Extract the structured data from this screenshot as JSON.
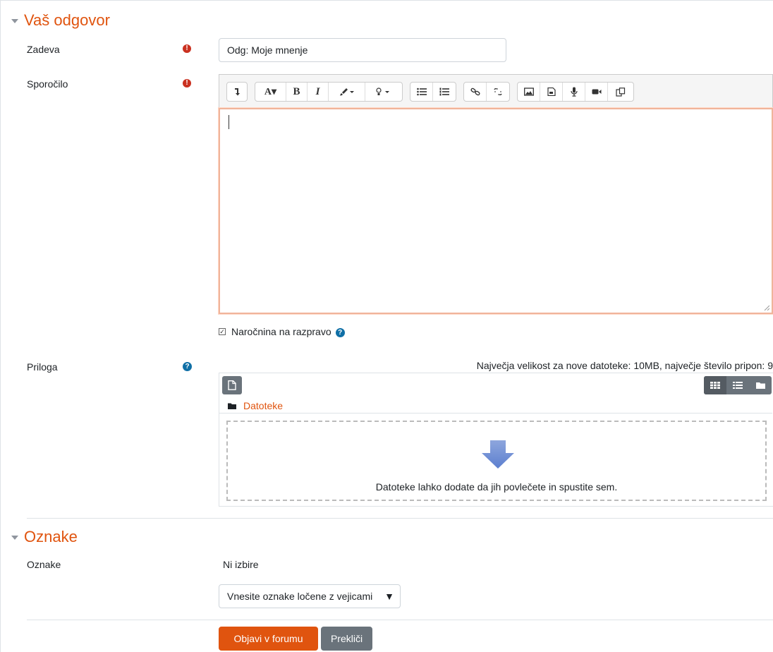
{
  "section_reply": {
    "title": "Vaš odgovor"
  },
  "subject": {
    "label": "Zadeva",
    "value": "Odg: Moje mnenje",
    "required_icon": "exclamation-circle-icon"
  },
  "message": {
    "label": "Sporočilo",
    "required_icon": "exclamation-circle-icon",
    "content": ""
  },
  "toolbar": {
    "items": [
      "collapse-icon",
      "font-icon",
      "bold-icon",
      "italic-icon",
      "brush-icon",
      "lightbulb-icon",
      "unordered-list-icon",
      "ordered-list-icon",
      "link-icon",
      "unlink-icon",
      "image-icon",
      "media-icon",
      "microphone-icon",
      "video-icon",
      "copy-icon"
    ],
    "font_glyph": "A▾",
    "bold_glyph": "B",
    "italic_glyph": "I"
  },
  "subscribe": {
    "label": "Naročnina na razpravo",
    "checked": true,
    "help_icon": "question-circle-icon"
  },
  "attachment": {
    "label": "Priloga",
    "help_icon": "question-circle-icon",
    "limits": "Največja velikost za nove datoteke: 10MB, največje število pripon: 9",
    "folder_label": "Datoteke",
    "drop_text": "Datoteke lahko dodate da jih povlečete in spustite sem."
  },
  "section_tags": {
    "title": "Oznake"
  },
  "tags": {
    "label": "Oznake",
    "selection": "Ni izbire",
    "placeholder": "Vnesite oznake ločene z vejicami",
    "arrow": "▼"
  },
  "actions": {
    "submit": "Objavi v forumu",
    "cancel": "Prekliči"
  },
  "colors": {
    "accent": "#e0540f",
    "required": "#ca3120",
    "help": "#0f6fa6",
    "secondary": "#6a737b"
  }
}
